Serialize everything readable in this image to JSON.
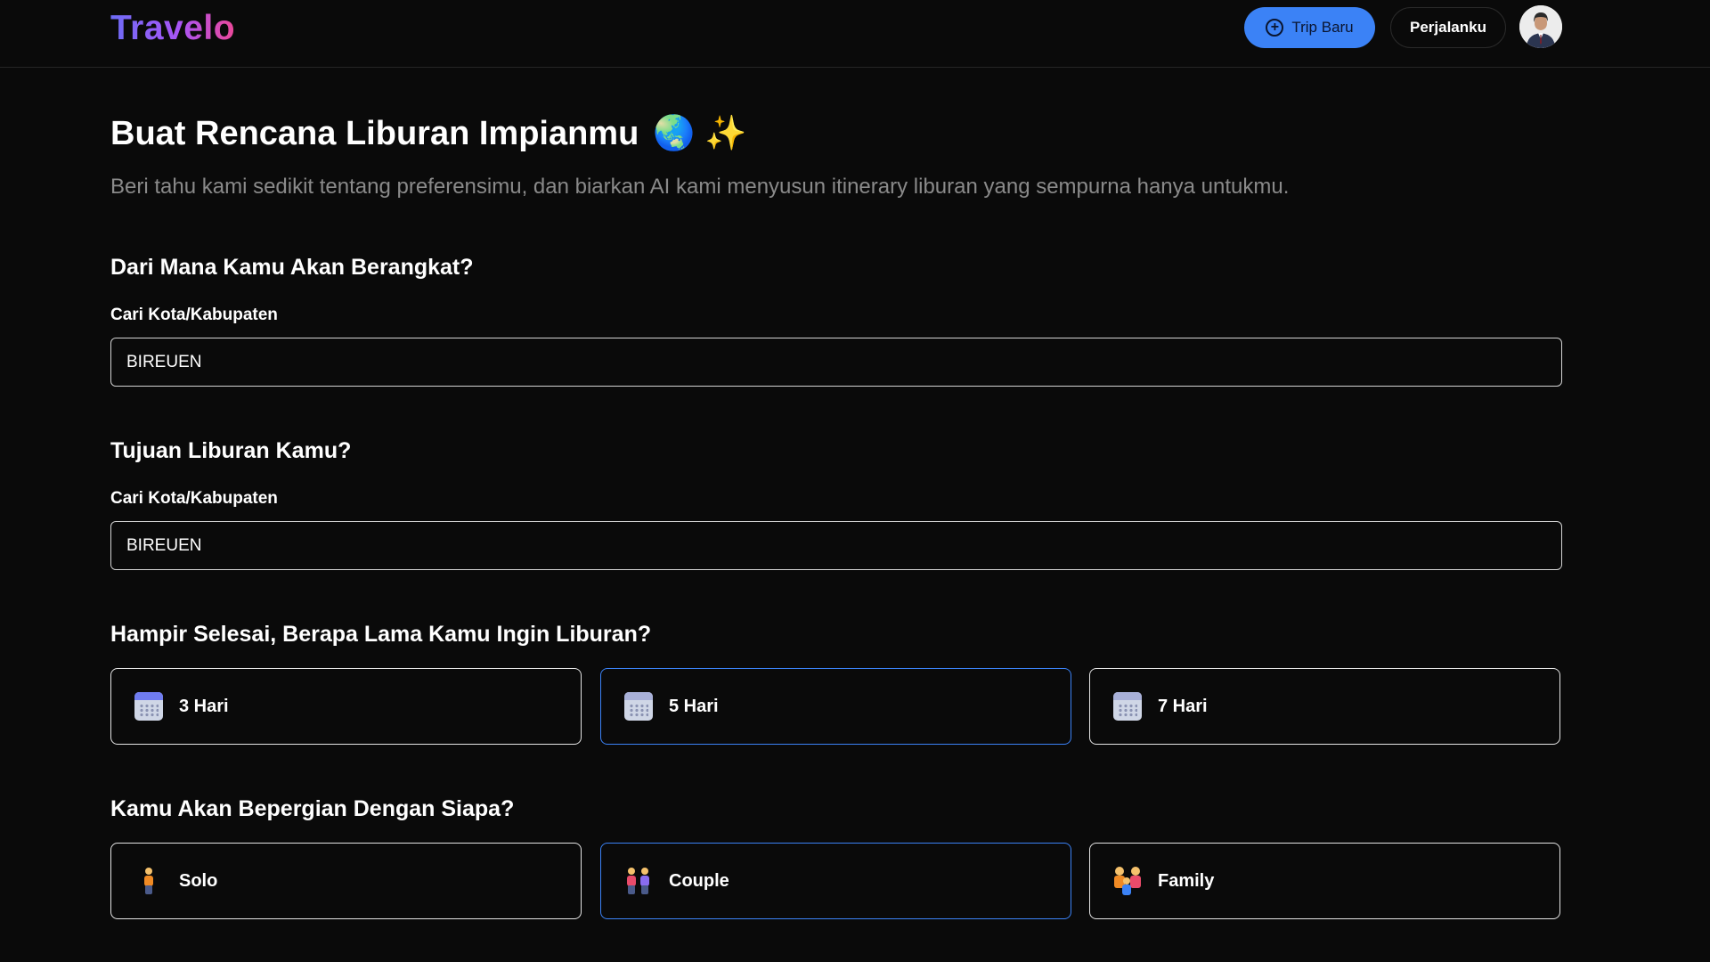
{
  "header": {
    "logo": "Travelo",
    "trip_baru_label": "Trip Baru",
    "perjalanku_label": "Perjalanku"
  },
  "main": {
    "title": "Buat Rencana Liburan Impianmu",
    "title_emoji": "🌏 ✨",
    "subtitle": "Beri tahu kami sedikit tentang preferensimu, dan biarkan AI kami menyusun itinerary liburan yang sempurna hanya untukmu.",
    "origin": {
      "section_title": "Dari Mana Kamu Akan Berangkat?",
      "label": "Cari Kota/Kabupaten",
      "value": "BIREUEN"
    },
    "destination": {
      "section_title": "Tujuan Liburan Kamu?",
      "label": "Cari Kota/Kabupaten",
      "value": "BIREUEN"
    },
    "duration": {
      "section_title": "Hampir Selesai, Berapa Lama Kamu Ingin Liburan?",
      "options": [
        {
          "label": "3 Hari",
          "icon": "calendar-icon",
          "selected": false
        },
        {
          "label": "5 Hari",
          "icon": "calendar-icon",
          "selected": true
        },
        {
          "label": "7 Hari",
          "icon": "calendar-icon",
          "selected": false
        }
      ]
    },
    "companion": {
      "section_title": "Kamu Akan Bepergian Dengan Siapa?",
      "options": [
        {
          "label": "Solo",
          "icon": "person-icon",
          "selected": false
        },
        {
          "label": "Couple",
          "icon": "couple-icon",
          "selected": true
        },
        {
          "label": "Family",
          "icon": "family-icon",
          "selected": false
        }
      ]
    }
  },
  "colors": {
    "background": "#0a0a0a",
    "accent": "#3b82f6",
    "muted_text": "#8a8a8a",
    "logo_gradient": [
      "#6d6cf6",
      "#a855f7",
      "#ec4899"
    ]
  }
}
